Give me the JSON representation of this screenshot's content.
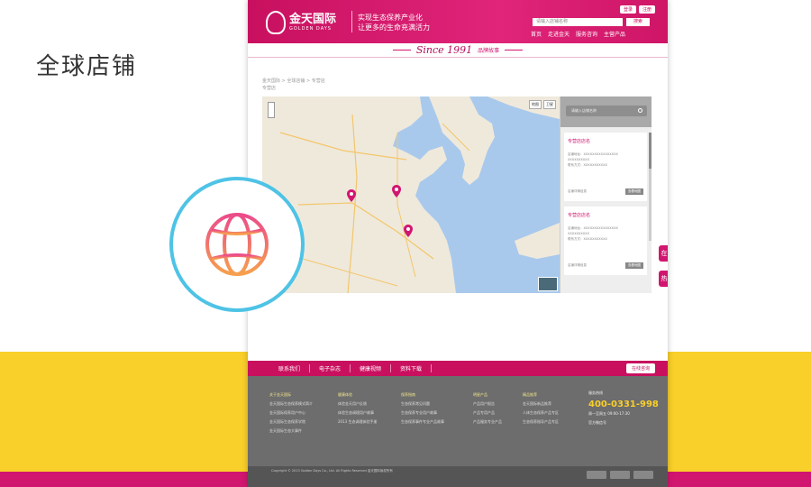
{
  "page_title": "全球店铺",
  "colors": {
    "magenta": "#d11670",
    "yellow": "#f9cf2a",
    "cyan_ring": "#4ec3e6"
  },
  "website": {
    "logo_cn": "金天国际",
    "logo_en": "GOLDEN DAYS",
    "slogan_line1": "实现生态保养产业化",
    "slogan_line2": "让更多的生命充满活力",
    "top_buttons": [
      "登录",
      "注册"
    ],
    "search_placeholder": "请输入店铺名称",
    "search_button": "搜索",
    "main_nav": [
      "首页",
      "走进金天",
      "服务咨询",
      "主营产品"
    ],
    "since_text": "Since 1991",
    "since_sub": "品牌故事",
    "breadcrumb_line1": "金天国际 > 全球店铺 > 专营店",
    "breadcrumb_line2": "专营店"
  },
  "store_panel": {
    "search_placeholder": "请输入店铺名称",
    "stores": [
      {
        "name": "专营店店名",
        "line1": "店铺地址：XXXXXXXXXXXXXXXX",
        "line2": "XXXXXXXXXX",
        "line3": "联系方式：XXXXXXXXXXX",
        "link": "店铺详情信息",
        "button": "查看地图"
      },
      {
        "name": "专营店店名",
        "line1": "店铺地址：XXXXXXXXXXXXXXXX",
        "line2": "XXXXXXXXXX",
        "line3": "联系方式：XXXXXXXXXXX",
        "link": "店铺详情信息",
        "button": "查看地图"
      }
    ]
  },
  "side_tabs": [
    "在",
    "热"
  ],
  "footer_nav": [
    "联系我们",
    "电子杂志",
    "健康视频",
    "资料下载"
  ],
  "footer_online": "在线咨询",
  "footer_columns": [
    {
      "head": "关于金天国际",
      "items": [
        "金天国际生态保养模式简介",
        "金天国际保养用户中心",
        "金天国际生态保养学院",
        "金天国际生态大事件"
      ]
    },
    {
      "head": "健康体验",
      "items": [
        "体验金天用户反馈",
        "体验生态调理用户故事",
        "2013 生态调理体验手册"
      ]
    },
    {
      "head": "保养指南",
      "items": [
        "生态保养常见问题",
        "生态保养专业用户故事",
        "生态保养事件专业产品故事"
      ]
    },
    {
      "head": "明星产品",
      "items": [
        "产品用户报告",
        "产品专用产品",
        "产品服务专业产品"
      ]
    },
    {
      "head": "精品推荐",
      "items": [
        "金天国际新品推荐",
        "人体生态保养产品专区",
        "生态保养指导产品专区"
      ]
    }
  ],
  "footer_contact": {
    "label": "服务热线",
    "phone": "400-0331-998",
    "hours": "周一至周五 09:00-17:30",
    "wechat": "官方微信号"
  },
  "copyright": "Copyright © 2013 Golden Days Co., Ltd. All Rights Reserved 金天国际版权所有"
}
